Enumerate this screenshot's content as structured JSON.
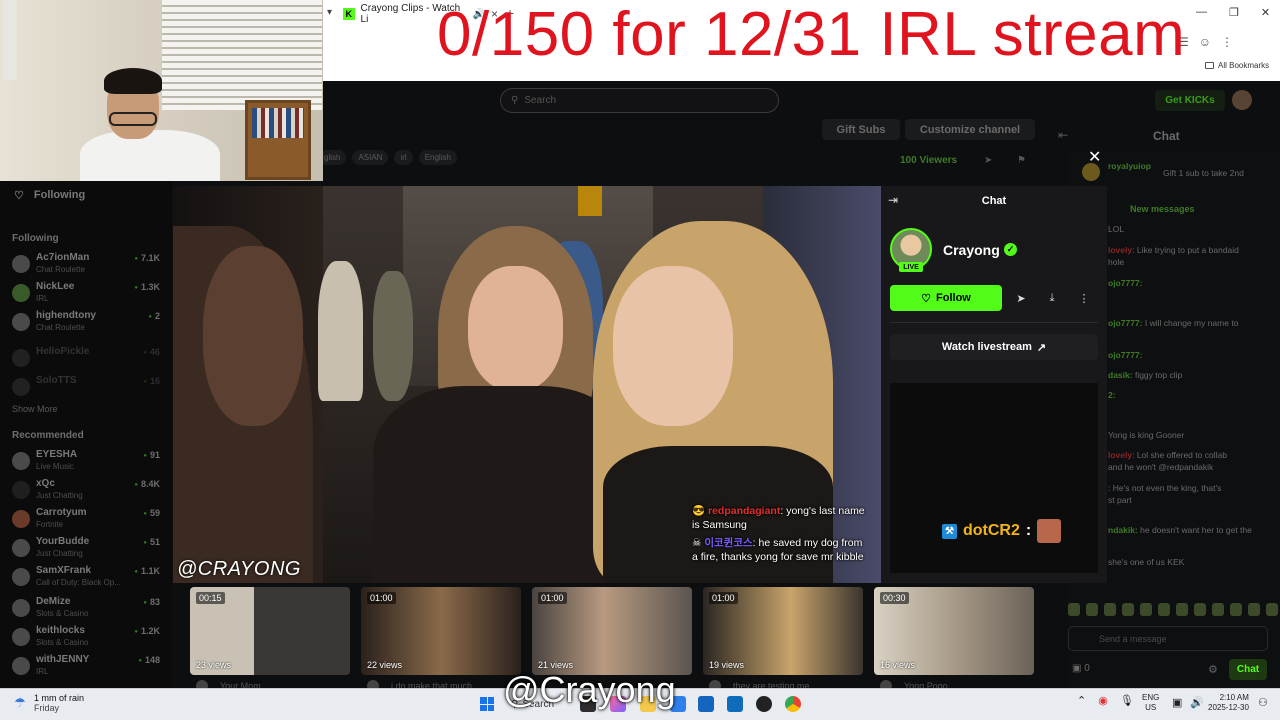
{
  "browser": {
    "tab_title": "Crayong Clips - Watch Li",
    "tab_favicon": "K",
    "new_tab": "+",
    "bookmarks_label": "All Bookmarks"
  },
  "overlay": {
    "banner_text": "0/150 for 12/31 IRL stream",
    "banner_color": "#e0141f",
    "watermark_video": "@CRAYONG",
    "watermark_bottom": "@Crayong"
  },
  "header": {
    "search_placeholder": "Search",
    "get_kicks": "Get KICKs",
    "gift_subs": "Gift Subs",
    "customize_channel": "Customize channel",
    "chat_title": "Chat",
    "tags": [
      "glish",
      "ASIAN",
      "irl",
      "English"
    ],
    "viewers": "100 Viewers"
  },
  "sidebar": {
    "following_title": "Following",
    "following_section": "Following",
    "following": [
      {
        "name": "Ac7ionMan",
        "sub": "Chat Roulette",
        "count": "7.1K"
      },
      {
        "name": "NickLee",
        "sub": "IRL",
        "count": "1.3K"
      },
      {
        "name": "highendtony",
        "sub": "Chat Roulette",
        "count": "2"
      },
      {
        "name": "HelloPickle",
        "sub": "",
        "count": "46"
      },
      {
        "name": "SoloTTS",
        "sub": "",
        "count": "16"
      }
    ],
    "show_more": "Show More",
    "recommended_section": "Recommended",
    "recommended": [
      {
        "name": "EYESHA",
        "sub": "Live Music",
        "count": "91"
      },
      {
        "name": "xQc",
        "sub": "Just Chatting",
        "count": "8.4K"
      },
      {
        "name": "Carrotyum",
        "sub": "Fortnite",
        "count": "59"
      },
      {
        "name": "YourBudde",
        "sub": "Just Chatting",
        "count": "51"
      },
      {
        "name": "SamXFrank",
        "sub": "Call of Duty: Black Op...",
        "count": "1.1K"
      },
      {
        "name": "DeMize",
        "sub": "Slots & Casino",
        "count": "83"
      },
      {
        "name": "keithlocks",
        "sub": "Slots & Casino",
        "count": "1.2K"
      },
      {
        "name": "withJENNY",
        "sub": "IRL",
        "count": "148"
      }
    ]
  },
  "video_chat": [
    {
      "user": "redpandagiant",
      "text": "yong's last name is Samsung"
    },
    {
      "user": "이코퀸코스",
      "text": "he saved my dog from a fire, thanks yong for save mr kibble"
    }
  ],
  "clip_panel": {
    "header": "Chat",
    "channel_name": "Crayong",
    "live_badge": "LIVE",
    "follow_label": "Follow",
    "watch_livestream": "Watch livestream",
    "embed_user": "dotCR2",
    "embed_sep": ":"
  },
  "bg_chat": {
    "pinned_user": "royalyuiop",
    "pinned_text": "Gift 1 sub to take 2nd",
    "new_messages": "New messages",
    "lines": [
      {
        "user": "",
        "text": "LOL"
      },
      {
        "user": "lovely",
        "text": ": Like trying to put a bandaid"
      },
      {
        "user": "",
        "text": "hole"
      },
      {
        "user": "ojo7777:",
        "text": ""
      },
      {
        "user": "ojo7777:",
        "text": "I will change my name to"
      },
      {
        "user": "ojo7777:",
        "text": ""
      },
      {
        "user": "dasik:",
        "text": "figgy top clip"
      },
      {
        "user": "2:",
        "text": ""
      },
      {
        "user": "",
        "text": "Yong is king Gooner"
      },
      {
        "user": "lovely",
        "text": ": Lol she offered to collab"
      },
      {
        "user": "",
        "text": "and he won't @redpandakik"
      },
      {
        "user": "",
        "text": ": He's not even the king, that's"
      },
      {
        "user": "",
        "text": "st part"
      },
      {
        "user": "ndakik:",
        "text": "he doesn't want her to get the"
      },
      {
        "user": "",
        "text": "she's one of us KEK"
      }
    ],
    "send_placeholder": "Send a message",
    "count": "0",
    "chat_button": "Chat"
  },
  "clips": [
    {
      "duration": "00:15",
      "views": "23 views",
      "title": "Your Mom"
    },
    {
      "duration": "01:00",
      "views": "22 views",
      "title": "i do make that much"
    },
    {
      "duration": "01:00",
      "views": "21 views",
      "title": ""
    },
    {
      "duration": "01:00",
      "views": "19 views",
      "title": "they are testing me"
    },
    {
      "duration": "00:30",
      "views": "16 views",
      "title": "Yong Pogo"
    }
  ],
  "taskbar": {
    "weather_line1": "1 mm of rain",
    "weather_line2": "Friday",
    "search_label": "Search",
    "lang1": "ENG",
    "lang2": "US",
    "time": "2:10 AM",
    "date": "2025-12-30"
  }
}
